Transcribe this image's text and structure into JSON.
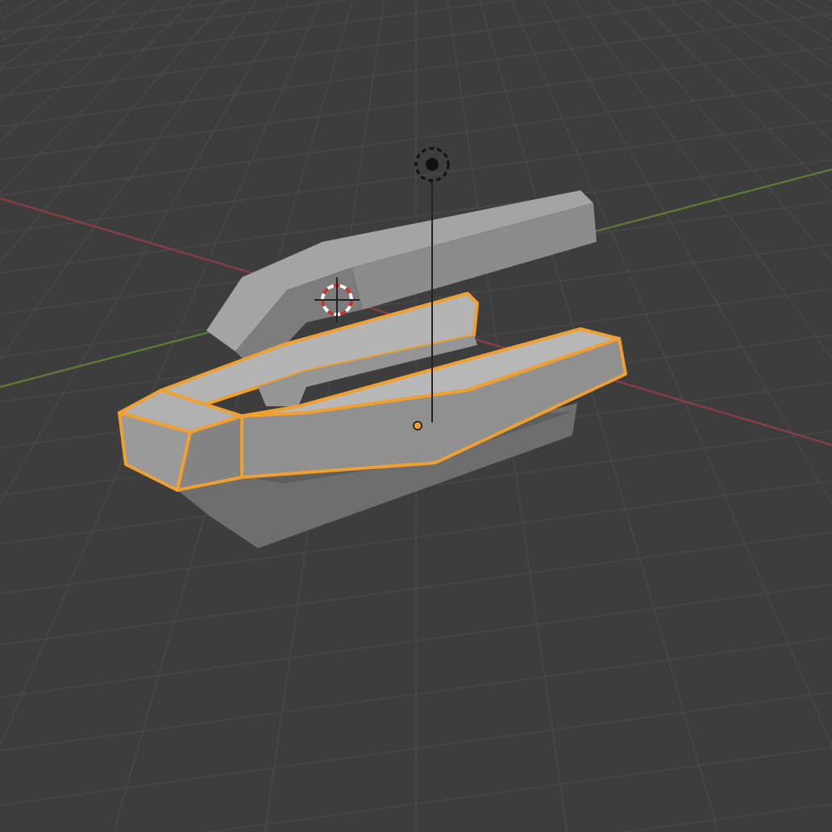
{
  "viewport": {
    "kind": "perspective",
    "selected": true
  }
}
